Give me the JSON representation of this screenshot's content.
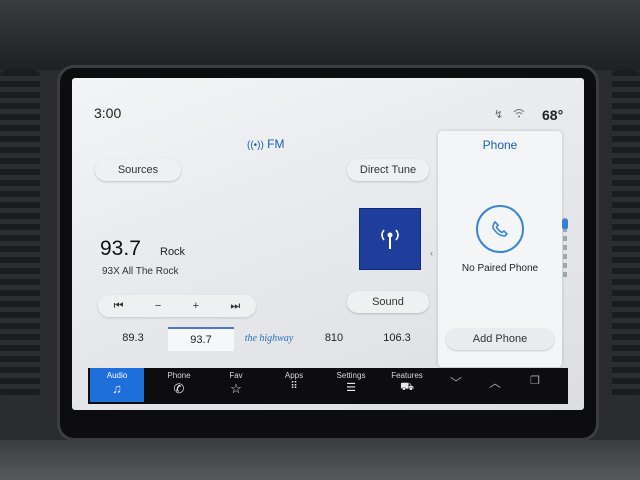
{
  "status": {
    "time": "3:00",
    "temperature": "68°"
  },
  "audio": {
    "band": "FM",
    "sources_label": "Sources",
    "direct_tune_label": "Direct Tune",
    "sound_label": "Sound",
    "frequency": "93.7",
    "genre": "Rock",
    "station_name": "93X All The Rock",
    "tune_controls": [
      "⏮",
      "−",
      "+",
      "⏭"
    ],
    "presets": [
      "89.3",
      "93.7",
      "the highway",
      "810",
      "106.3"
    ],
    "active_preset": "93.7"
  },
  "phone": {
    "title": "Phone",
    "status": "No Paired Phone",
    "add_label": "Add Phone"
  },
  "nav": {
    "items": [
      {
        "label": "Audio",
        "icon": "music-note-icon",
        "active": true
      },
      {
        "label": "Phone",
        "icon": "phone-icon"
      },
      {
        "label": "Fav",
        "icon": "star-add-icon"
      },
      {
        "label": "Apps",
        "icon": "apps-grid-icon"
      },
      {
        "label": "Settings",
        "icon": "sliders-icon"
      },
      {
        "label": "Features",
        "icon": "car-icon"
      }
    ]
  },
  "colors": {
    "accent": "#1e6fd9",
    "header_blue": "#1a5fb4",
    "tile_blue": "#1f3e9c"
  }
}
